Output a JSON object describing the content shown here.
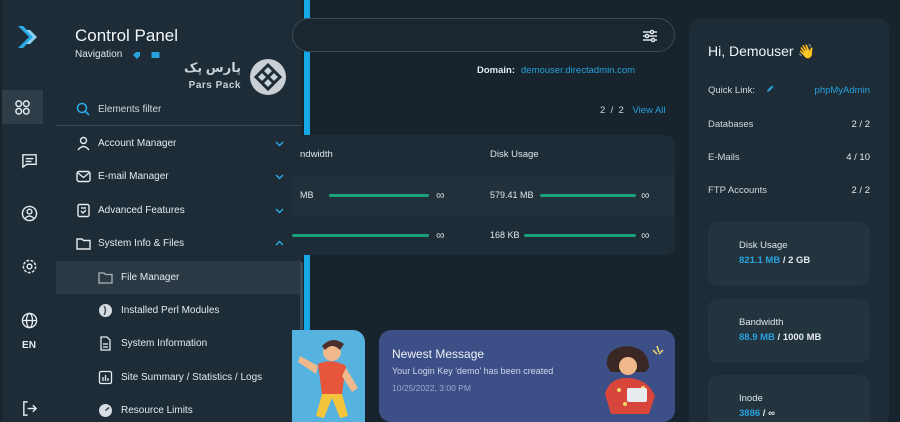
{
  "nav": {
    "title": "Control Panel",
    "subtitle": "Navigation",
    "filter_label": "Elements filter",
    "brand_fa": "پارس پک",
    "brand_en": "Pars Pack",
    "items": [
      {
        "label": "Account Manager",
        "icon": "user-icon"
      },
      {
        "label": "E-mail Manager",
        "icon": "mail-icon"
      },
      {
        "label": "Advanced Features",
        "icon": "tools-icon"
      },
      {
        "label": "System Info & Files",
        "icon": "folder-icon"
      }
    ],
    "sub_items": [
      {
        "label": "File Manager",
        "icon": "folder-icon"
      },
      {
        "label": "Installed Perl Modules",
        "icon": "perl-icon"
      },
      {
        "label": "System Information",
        "icon": "document-icon"
      },
      {
        "label": "Site Summary / Statistics / Logs",
        "icon": "chart-icon"
      },
      {
        "label": "Resource Limits",
        "icon": "gauge-icon"
      }
    ]
  },
  "rail": {
    "language": "EN"
  },
  "main": {
    "domain_label": "Domain:",
    "domain_value": "demouser.directadmin.com",
    "paging_current": "2",
    "paging_sep": "/",
    "paging_total": "2",
    "view_all": "View All",
    "usage_headers": {
      "bandwidth": "ndwidth",
      "disk": "Disk Usage"
    },
    "usage_rows": [
      {
        "bandwidth": "MB",
        "bandwidth_inf": "∞",
        "disk": "579.41 MB",
        "disk_inf": "∞"
      },
      {
        "bandwidth": "",
        "bandwidth_inf": "∞",
        "disk": "168 KB",
        "disk_inf": "∞"
      }
    ],
    "message": {
      "title": "Newest Message",
      "text": "Your Login Key 'demo' has been created",
      "date": "10/25/2022, 3:00 PM"
    }
  },
  "right": {
    "greeting": "Hi, Demouser 👋",
    "quick_link_label": "Quick Link:",
    "quick_link_value": "phpMyAdmin",
    "rows": [
      {
        "label": "Databases",
        "value": "2 / 2"
      },
      {
        "label": "E-Mails",
        "value": "4 / 10"
      },
      {
        "label": "FTP Accounts",
        "value": "2 / 2"
      }
    ],
    "stats": [
      {
        "title": "Disk Usage",
        "used": "821.1 MB",
        "limit": "2 GB"
      },
      {
        "title": "Bandwidth",
        "used": "88.9 MB",
        "limit": "1000 MB"
      },
      {
        "title": "Inode",
        "used": "3886",
        "limit": "∞"
      }
    ]
  },
  "colors": {
    "accent": "#16a7e6",
    "link": "#27a2dc",
    "bar": "#1aa37a",
    "message_card": "#3d4f87"
  }
}
